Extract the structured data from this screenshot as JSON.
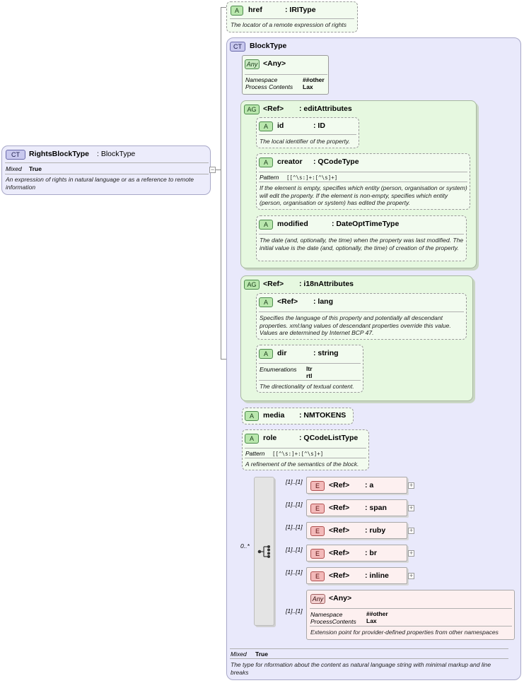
{
  "root": {
    "badge": "CT",
    "name": "RightsBlockType",
    "type": ": BlockType",
    "mixed_label": "Mixed",
    "mixed_value": "True",
    "description": "An expression of rights in natural language or as a reference to remote information"
  },
  "href": {
    "badge": "A",
    "name": "href",
    "type": ": IRIType",
    "description": "The locator of a remote expression of rights"
  },
  "blocktype": {
    "badge": "CT",
    "name": "BlockType",
    "mixed_label": "Mixed",
    "mixed_value": "True",
    "description": "The type for nformation about the content as natural language string with minimal markup and line breaks"
  },
  "any_attr": {
    "badge": "Any",
    "name": "<Any>",
    "ns_label": "Namespace",
    "ns_value": "##other",
    "pc_label": "Process Contents",
    "pc_value": "Lax"
  },
  "edit_attributes": {
    "badge": "AG",
    "ref": "<Ref>",
    "name": ": editAttributes",
    "id": {
      "badge": "A",
      "name": "id",
      "type": ": ID",
      "description": "The local identifier of the property."
    },
    "creator": {
      "badge": "A",
      "name": "creator",
      "type": ": QCodeType",
      "pattern_label": "Pattern",
      "pattern_value": "[[^\\s:]+:[^\\s]+]",
      "description": "If the element is empty, specifies which entity (person, organisation or system) will edit the property. If the element is non-empty, specifies which entity (person, organisation or system) has edited the property."
    },
    "modified": {
      "badge": "A",
      "name": "modified",
      "type": ": DateOptTimeType",
      "description": "The date (and, optionally, the time) when the property was last modified. The initial value is the date (and, optionally, the time) of creation of the property."
    }
  },
  "i18n_attributes": {
    "badge": "AG",
    "ref": "<Ref>",
    "name": ": i18nAttributes",
    "lang": {
      "badge": "A",
      "ref": "<Ref>",
      "name": ": lang",
      "description": "Specifies the language of this property and potentially all descendant properties. xml:lang values of descendant properties override this value. Values are determined by Internet BCP 47."
    },
    "dir": {
      "badge": "A",
      "name": "dir",
      "type": ": string",
      "enum_label": "Enumerations",
      "enum_values": [
        "ltr",
        "rtl"
      ],
      "description": "The directionality of textual content."
    }
  },
  "media": {
    "badge": "A",
    "name": "media",
    "type": ": NMTOKENS"
  },
  "role": {
    "badge": "A",
    "name": "role",
    "type": ": QCodeListType",
    "pattern_label": "Pattern",
    "pattern_value": "[[^\\s:]+:[^\\s]+]",
    "description": "A refinement of the semantics of the block."
  },
  "choice": {
    "cardinality": "0..*",
    "elements": [
      {
        "badge": "E",
        "ref": "<Ref>",
        "name": ": a",
        "cardinality": "[1]..[1]"
      },
      {
        "badge": "E",
        "ref": "<Ref>",
        "name": ": span",
        "cardinality": "[1]..[1]"
      },
      {
        "badge": "E",
        "ref": "<Ref>",
        "name": ": ruby",
        "cardinality": "[1]..[1]"
      },
      {
        "badge": "E",
        "ref": "<Ref>",
        "name": ": br",
        "cardinality": "[1]..[1]"
      },
      {
        "badge": "E",
        "ref": "<Ref>",
        "name": ": inline",
        "cardinality": "[1]..[1]"
      }
    ],
    "any_element": {
      "badge": "Any",
      "name": "<Any>",
      "cardinality": "[1]..[1]",
      "ns_label": "Namespace",
      "ns_value": "##other",
      "pc_label": "ProcessContents",
      "pc_value": "Lax",
      "description": "Extension point for provider-defined properties from other namespaces"
    }
  }
}
